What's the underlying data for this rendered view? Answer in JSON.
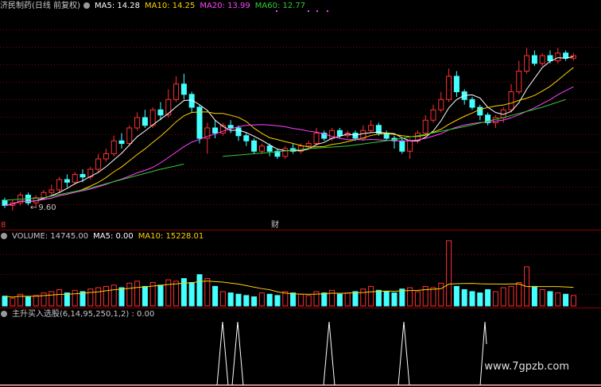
{
  "main": {
    "stock_name": "济民制药",
    "period": "(日线 前复权)",
    "ma": [
      {
        "label": "MA5: 14.28",
        "color": "#ffffff"
      },
      {
        "label": "MA10: 14.25",
        "color": "#ffd200"
      },
      {
        "label": "MA20: 13.99",
        "color": "#ff44ff"
      },
      {
        "label": "MA60: 12.77",
        "color": "#33cc33"
      }
    ],
    "low_marker": "9.60",
    "event_marker": "财",
    "left_marker": "8"
  },
  "volume": {
    "title": "VOLUME: 14745.00",
    "ma5": "MA5: 0.00",
    "ma10": "MA10: 15228.01"
  },
  "indicator": {
    "title": "主升买入选股(6,14,95,250,1,2) : 0.00"
  },
  "watermark": "www.7gpzb.com",
  "colors": {
    "up": "#ff3030",
    "down": "#44ffff",
    "grid": "#8b0000",
    "ma5": "#ffffff",
    "ma10": "#ffd200",
    "ma20": "#ff44ff",
    "ma60": "#33cc33"
  },
  "chart_data": {
    "type": "candlestick",
    "candles": [
      [
        10.0,
        9.8,
        10.1,
        9.7
      ],
      [
        9.8,
        9.9,
        10.0,
        9.6
      ],
      [
        9.9,
        10.2,
        10.3,
        9.8
      ],
      [
        10.2,
        9.9,
        10.3,
        9.8
      ],
      [
        9.9,
        10.1,
        10.2,
        9.7
      ],
      [
        10.1,
        10.3,
        10.4,
        10.0
      ],
      [
        10.3,
        10.4,
        10.6,
        10.2
      ],
      [
        10.4,
        10.8,
        10.9,
        10.3
      ],
      [
        10.8,
        10.7,
        11.0,
        10.5
      ],
      [
        10.7,
        11.0,
        11.1,
        10.6
      ],
      [
        11.0,
        10.9,
        11.2,
        10.7
      ],
      [
        10.9,
        11.2,
        11.3,
        10.8
      ],
      [
        11.2,
        11.6,
        11.8,
        11.1
      ],
      [
        11.6,
        11.8,
        12.0,
        11.5
      ],
      [
        11.8,
        12.3,
        12.5,
        11.7
      ],
      [
        12.3,
        12.2,
        12.6,
        12.0
      ],
      [
        12.2,
        12.8,
        12.9,
        12.1
      ],
      [
        12.8,
        13.2,
        13.4,
        12.7
      ],
      [
        13.2,
        12.9,
        13.5,
        12.8
      ],
      [
        12.9,
        13.5,
        13.6,
        12.8
      ],
      [
        13.5,
        13.3,
        13.8,
        13.1
      ],
      [
        13.3,
        13.9,
        14.3,
        13.2
      ],
      [
        13.9,
        14.5,
        14.8,
        13.8
      ],
      [
        14.5,
        14.1,
        14.9,
        13.9
      ],
      [
        14.1,
        13.6,
        14.2,
        13.4
      ],
      [
        13.6,
        12.4,
        13.7,
        12.2
      ],
      [
        12.4,
        12.8,
        13.0,
        11.8
      ],
      [
        12.8,
        12.6,
        13.1,
        12.4
      ],
      [
        12.6,
        12.9,
        13.0,
        12.5
      ],
      [
        12.9,
        12.8,
        13.1,
        12.6
      ],
      [
        12.8,
        12.5,
        12.9,
        12.3
      ],
      [
        12.5,
        12.3,
        12.6,
        12.1
      ],
      [
        12.3,
        11.9,
        12.4,
        11.8
      ],
      [
        11.9,
        12.1,
        12.2,
        11.8
      ],
      [
        12.1,
        11.9,
        12.2,
        11.7
      ],
      [
        11.9,
        11.7,
        12.0,
        11.6
      ],
      [
        11.7,
        12.0,
        12.1,
        11.6
      ],
      [
        12.0,
        11.9,
        12.2,
        11.8
      ],
      [
        11.9,
        12.1,
        12.2,
        11.8
      ],
      [
        12.1,
        12.2,
        12.3,
        12.0
      ],
      [
        12.2,
        12.6,
        12.8,
        12.1
      ],
      [
        12.6,
        12.4,
        12.7,
        12.3
      ],
      [
        12.4,
        12.7,
        12.8,
        12.3
      ],
      [
        12.7,
        12.5,
        12.8,
        12.4
      ],
      [
        12.5,
        12.6,
        12.7,
        12.4
      ],
      [
        12.6,
        12.4,
        12.7,
        12.3
      ],
      [
        12.4,
        12.7,
        12.9,
        12.3
      ],
      [
        12.7,
        12.9,
        13.1,
        12.6
      ],
      [
        12.9,
        12.6,
        13.0,
        12.5
      ],
      [
        12.6,
        12.4,
        12.7,
        12.3
      ],
      [
        12.4,
        12.3,
        12.5,
        12.0
      ],
      [
        12.3,
        11.9,
        12.4,
        11.8
      ],
      [
        11.9,
        12.3,
        12.4,
        11.6
      ],
      [
        12.3,
        12.6,
        12.7,
        12.2
      ],
      [
        12.6,
        13.1,
        13.3,
        12.5
      ],
      [
        13.1,
        13.5,
        13.7,
        13.0
      ],
      [
        13.5,
        13.9,
        14.2,
        13.4
      ],
      [
        13.9,
        14.8,
        15.1,
        13.8
      ],
      [
        14.8,
        14.2,
        15.0,
        14.0
      ],
      [
        14.2,
        13.9,
        14.3,
        13.7
      ],
      [
        13.9,
        13.6,
        14.0,
        13.5
      ],
      [
        13.6,
        13.3,
        13.7,
        13.1
      ],
      [
        13.3,
        13.0,
        13.4,
        12.9
      ],
      [
        13.0,
        13.2,
        13.3,
        12.8
      ],
      [
        13.2,
        13.5,
        13.6,
        13.0
      ],
      [
        13.5,
        14.2,
        14.5,
        13.4
      ],
      [
        14.2,
        15.0,
        15.4,
        14.1
      ],
      [
        15.0,
        15.6,
        15.9,
        14.9
      ],
      [
        15.6,
        15.3,
        15.8,
        15.2
      ],
      [
        15.3,
        15.6,
        15.7,
        15.2
      ],
      [
        15.6,
        15.4,
        15.8,
        15.3
      ],
      [
        15.4,
        15.7,
        15.9,
        15.3
      ],
      [
        15.7,
        15.5,
        15.8,
        15.4
      ],
      [
        15.5,
        15.6,
        15.7,
        15.4
      ]
    ],
    "volume_ratio": [
      0.15,
      0.12,
      0.18,
      0.14,
      0.16,
      0.2,
      0.22,
      0.25,
      0.2,
      0.24,
      0.22,
      0.26,
      0.28,
      0.3,
      0.32,
      0.28,
      0.35,
      0.38,
      0.3,
      0.36,
      0.32,
      0.4,
      0.38,
      0.42,
      0.36,
      0.48,
      0.42,
      0.3,
      0.22,
      0.2,
      0.18,
      0.16,
      0.14,
      0.2,
      0.18,
      0.16,
      0.22,
      0.2,
      0.18,
      0.16,
      0.22,
      0.2,
      0.24,
      0.18,
      0.2,
      0.22,
      0.26,
      0.3,
      0.24,
      0.22,
      0.2,
      0.26,
      0.28,
      0.22,
      0.3,
      0.28,
      0.35,
      1.0,
      0.3,
      0.25,
      0.22,
      0.2,
      0.25,
      0.22,
      0.28,
      0.3,
      0.36,
      0.6,
      0.3,
      0.25,
      0.22,
      0.2,
      0.18,
      0.16
    ],
    "signals": [
      55,
      60,
      83,
      103,
      123
    ]
  }
}
